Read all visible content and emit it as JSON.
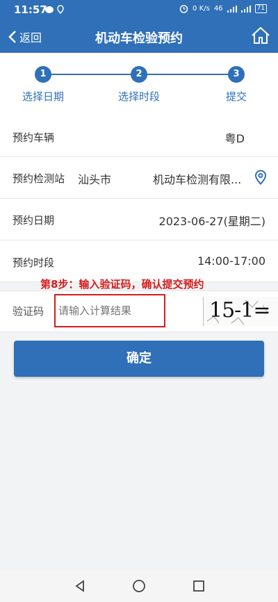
{
  "status": {
    "time": "11:57",
    "speed": "0 K/s",
    "signal": "46",
    "battery": "71"
  },
  "header": {
    "back_label": "返回",
    "title": "机动车检验预约"
  },
  "steps": [
    {
      "num": "1",
      "label": "选择日期"
    },
    {
      "num": "2",
      "label": "选择时段"
    },
    {
      "num": "3",
      "label": "提交"
    }
  ],
  "form": {
    "vehicle_label": "预约车辆",
    "vehicle_value": "粤D",
    "station_label": "预约检测站",
    "station_city": "汕头市",
    "station_name": "机动车检测有限...",
    "date_label": "预约日期",
    "date_value": "2023-06-27(星期二)",
    "period_label": "预约时段",
    "period_value": "14:00-17:00"
  },
  "annotation": "第8步：输入验证码，确认提交预约",
  "captcha": {
    "label": "验证码",
    "placeholder": "请输入计算结果",
    "image_text": "15-1="
  },
  "confirm_label": "确定",
  "colors": {
    "primary": "#2f70b8",
    "annotation": "#d41c1c"
  }
}
